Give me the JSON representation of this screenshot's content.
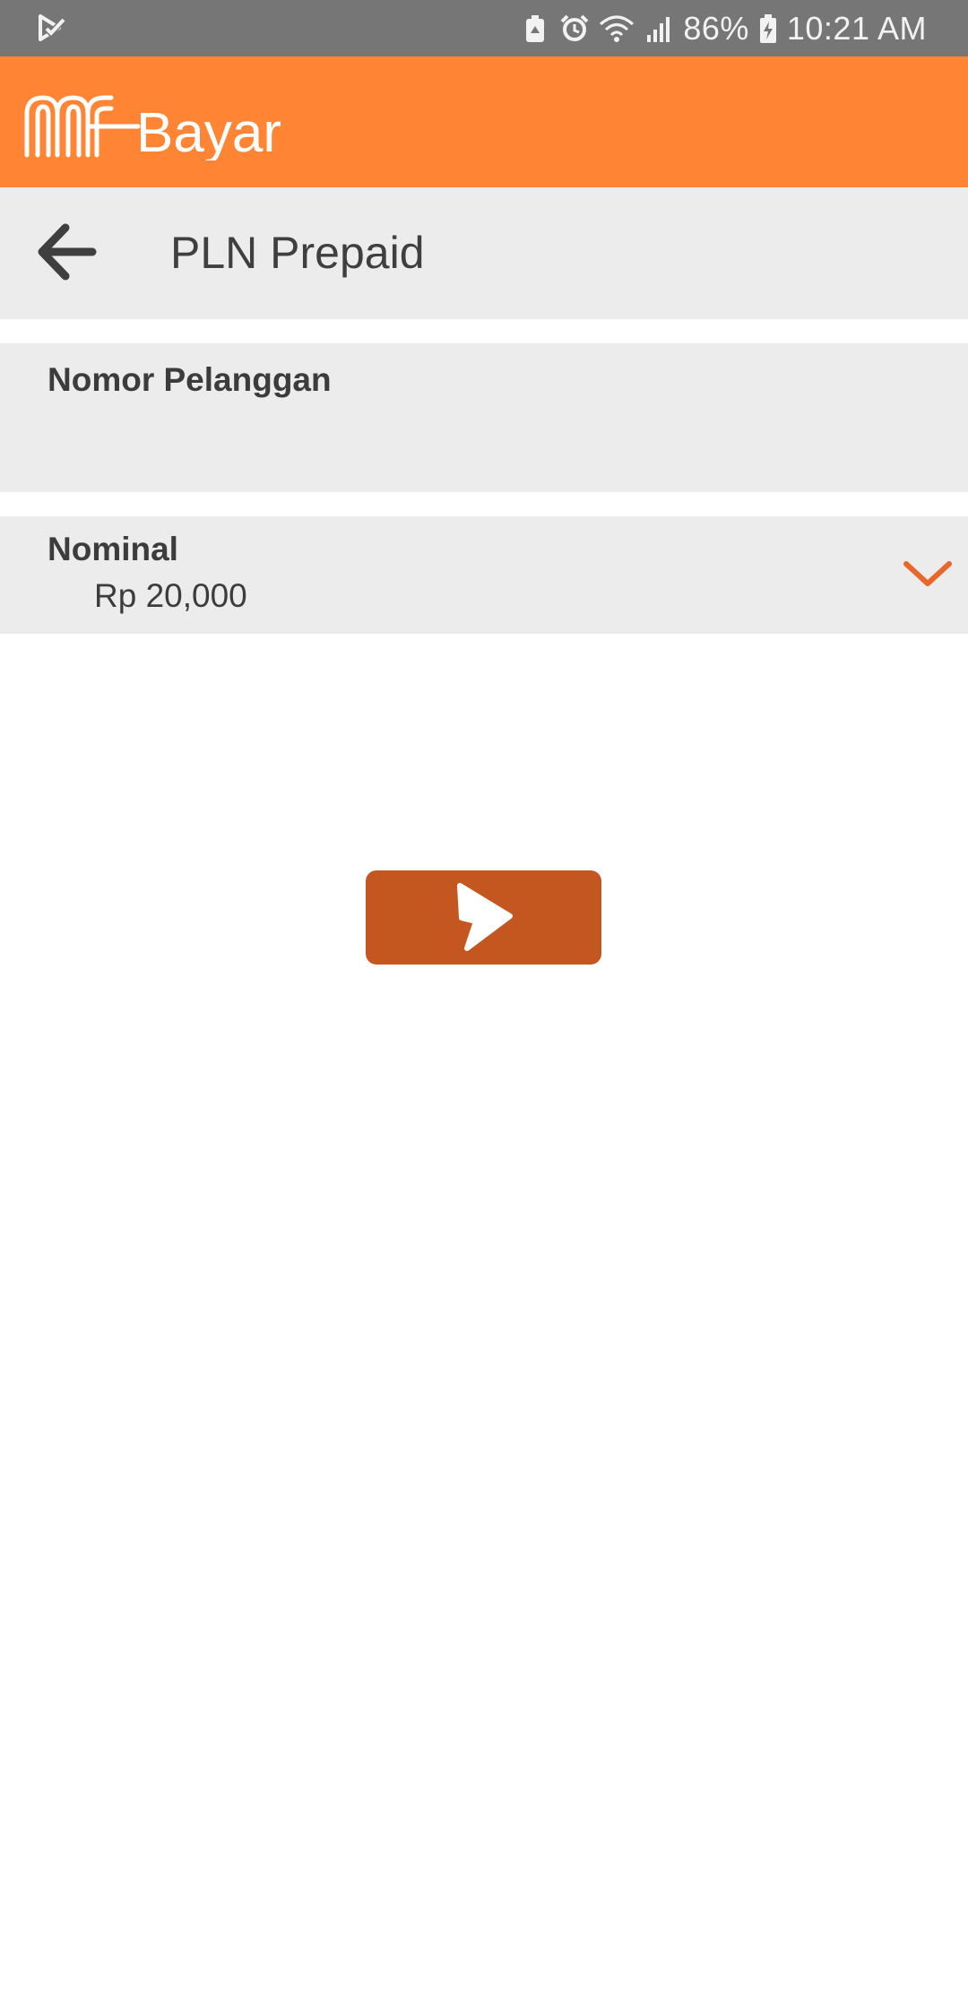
{
  "status_bar": {
    "battery_percent": "86%",
    "time": "10:21 AM",
    "icons": [
      "play-store-notification-icon",
      "battery-saver-icon",
      "alarm-icon",
      "wifi-icon",
      "signal-icon",
      "battery-charging-icon"
    ]
  },
  "app_bar": {
    "brand": "mBayar",
    "background_color": "#ff8534"
  },
  "title_bar": {
    "back_icon": "arrow-left-icon",
    "title": "PLN Prepaid"
  },
  "form": {
    "customer_number": {
      "label": "Nomor Pelanggan",
      "value": ""
    },
    "nominal": {
      "label": "Nominal",
      "value": "Rp 20,000",
      "dropdown_icon": "chevron-down-icon",
      "accent_color": "#e8672b"
    }
  },
  "next_button": {
    "icon": "next-arrow-icon",
    "color": "#c4561f"
  }
}
